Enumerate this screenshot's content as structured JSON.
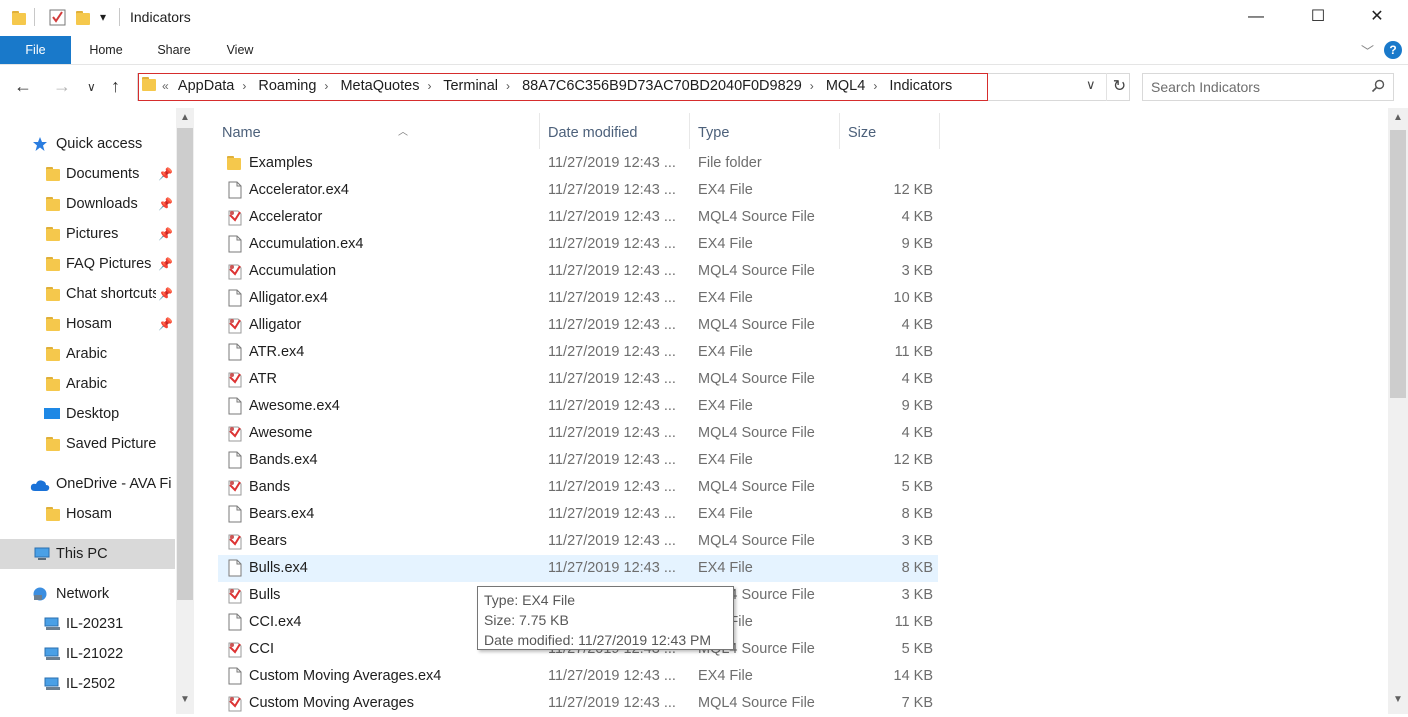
{
  "window": {
    "title": "Indicators",
    "minimize": "—",
    "maximize": "☐",
    "close": "✕"
  },
  "ribbon": {
    "tabs": [
      "File",
      "Home",
      "Share",
      "View"
    ],
    "help": "?"
  },
  "address": {
    "overflow": "«",
    "crumbs": [
      "AppData",
      "Roaming",
      "MetaQuotes",
      "Terminal",
      "88A7C6C356B9D73AC70BD2040F0D9829",
      "MQL4",
      "Indicators"
    ],
    "separator": "›"
  },
  "search": {
    "placeholder": "Search Indicators"
  },
  "nav": {
    "quick_access": "Quick access",
    "items": [
      {
        "label": "Documents",
        "icon": "documents-folder-icon",
        "pinned": true
      },
      {
        "label": "Downloads",
        "icon": "downloads-folder-icon",
        "pinned": true
      },
      {
        "label": "Pictures",
        "icon": "pictures-folder-icon",
        "pinned": true
      },
      {
        "label": "FAQ Pictures",
        "icon": "folder-icon",
        "pinned": true
      },
      {
        "label": "Chat shortcuts",
        "icon": "folder-icon",
        "pinned": true
      },
      {
        "label": "Hosam",
        "icon": "folder-icon",
        "pinned": true
      },
      {
        "label": "Arabic",
        "icon": "folder-icon",
        "pinned": false
      },
      {
        "label": "Arabic",
        "icon": "folder-icon",
        "pinned": false
      },
      {
        "label": "Desktop",
        "icon": "desktop-icon",
        "pinned": false
      },
      {
        "label": "Saved Pictures",
        "icon": "folder-icon",
        "pinned": false
      }
    ],
    "onedrive": "OneDrive - AVA Fi",
    "onedrive_items": [
      "Hosam"
    ],
    "this_pc": "This PC",
    "network": "Network",
    "network_items": [
      "IL-20231",
      "IL-21022",
      "IL-2502"
    ]
  },
  "columns": {
    "name": "Name",
    "date": "Date modified",
    "type": "Type",
    "size": "Size"
  },
  "files": [
    {
      "name": "Examples",
      "date": "11/27/2019 12:43 ...",
      "type": "File folder",
      "size": "",
      "icon": "folder"
    },
    {
      "name": "Accelerator.ex4",
      "date": "11/27/2019 12:43 ...",
      "type": "EX4 File",
      "size": "12 KB",
      "icon": "ex4"
    },
    {
      "name": "Accelerator",
      "date": "11/27/2019 12:43 ...",
      "type": "MQL4 Source File",
      "size": "4 KB",
      "icon": "mq4"
    },
    {
      "name": "Accumulation.ex4",
      "date": "11/27/2019 12:43 ...",
      "type": "EX4 File",
      "size": "9 KB",
      "icon": "ex4"
    },
    {
      "name": "Accumulation",
      "date": "11/27/2019 12:43 ...",
      "type": "MQL4 Source File",
      "size": "3 KB",
      "icon": "mq4"
    },
    {
      "name": "Alligator.ex4",
      "date": "11/27/2019 12:43 ...",
      "type": "EX4 File",
      "size": "10 KB",
      "icon": "ex4"
    },
    {
      "name": "Alligator",
      "date": "11/27/2019 12:43 ...",
      "type": "MQL4 Source File",
      "size": "4 KB",
      "icon": "mq4"
    },
    {
      "name": "ATR.ex4",
      "date": "11/27/2019 12:43 ...",
      "type": "EX4 File",
      "size": "11 KB",
      "icon": "ex4"
    },
    {
      "name": "ATR",
      "date": "11/27/2019 12:43 ...",
      "type": "MQL4 Source File",
      "size": "4 KB",
      "icon": "mq4"
    },
    {
      "name": "Awesome.ex4",
      "date": "11/27/2019 12:43 ...",
      "type": "EX4 File",
      "size": "9 KB",
      "icon": "ex4"
    },
    {
      "name": "Awesome",
      "date": "11/27/2019 12:43 ...",
      "type": "MQL4 Source File",
      "size": "4 KB",
      "icon": "mq4"
    },
    {
      "name": "Bands.ex4",
      "date": "11/27/2019 12:43 ...",
      "type": "EX4 File",
      "size": "12 KB",
      "icon": "ex4"
    },
    {
      "name": "Bands",
      "date": "11/27/2019 12:43 ...",
      "type": "MQL4 Source File",
      "size": "5 KB",
      "icon": "mq4"
    },
    {
      "name": "Bears.ex4",
      "date": "11/27/2019 12:43 ...",
      "type": "EX4 File",
      "size": "8 KB",
      "icon": "ex4"
    },
    {
      "name": "Bears",
      "date": "11/27/2019 12:43 ...",
      "type": "MQL4 Source File",
      "size": "3 KB",
      "icon": "mq4"
    },
    {
      "name": "Bulls.ex4",
      "date": "11/27/2019 12:43 ...",
      "type": "EX4 File",
      "size": "8 KB",
      "icon": "ex4",
      "hover": true
    },
    {
      "name": "Bulls",
      "date": "11/27/2019 12:43 ...",
      "type": "MQL4 Source File",
      "size": "3 KB",
      "icon": "mq4"
    },
    {
      "name": "CCI.ex4",
      "date": "11/27/2019 12:43 ...",
      "type": "EX4 File",
      "size": "11 KB",
      "icon": "ex4"
    },
    {
      "name": "CCI",
      "date": "11/27/2019 12:43 ...",
      "type": "MQL4 Source File",
      "size": "5 KB",
      "icon": "mq4"
    },
    {
      "name": "Custom Moving Averages.ex4",
      "date": "11/27/2019 12:43 ...",
      "type": "EX4 File",
      "size": "14 KB",
      "icon": "ex4"
    },
    {
      "name": "Custom Moving Averages",
      "date": "11/27/2019 12:43 ...",
      "type": "MQL4 Source File",
      "size": "7 KB",
      "icon": "mq4"
    }
  ],
  "tooltip": {
    "type": "Type: EX4 File",
    "size": "Size: 7.75 KB",
    "date": "Date modified: 11/27/2019 12:43 PM"
  }
}
